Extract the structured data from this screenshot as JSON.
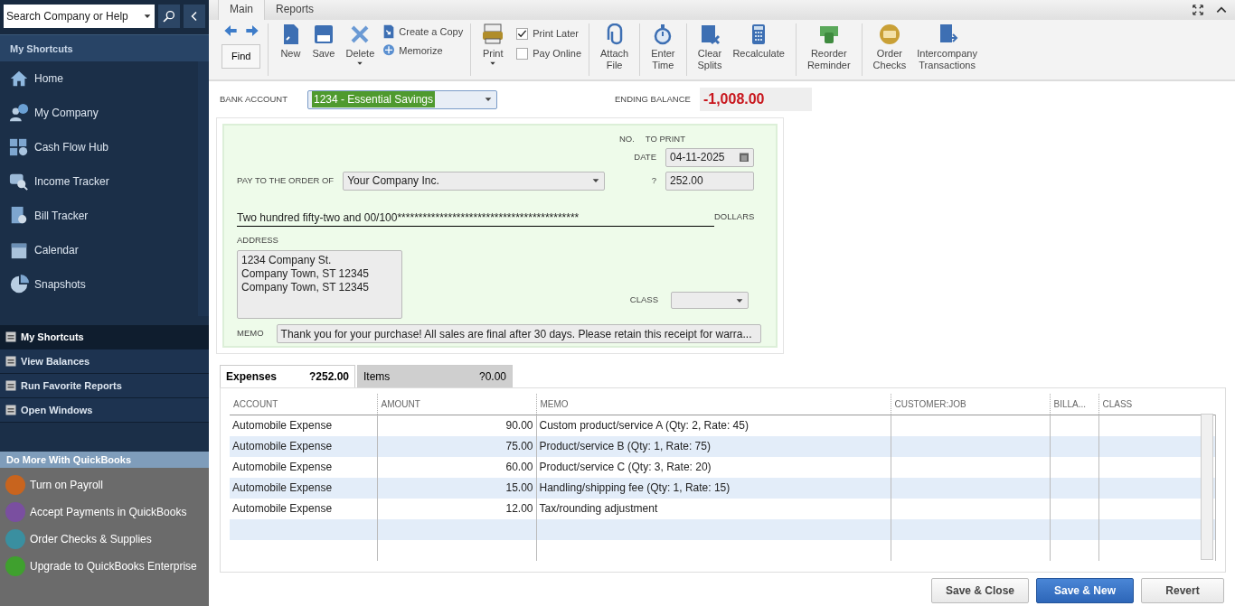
{
  "search": {
    "value": "Search Company or Help"
  },
  "sidebar": {
    "header": "My Shortcuts",
    "shortcuts": [
      {
        "label": "Home"
      },
      {
        "label": "My Company"
      },
      {
        "label": "Cash Flow Hub"
      },
      {
        "label": "Income Tracker"
      },
      {
        "label": "Bill Tracker"
      },
      {
        "label": "Calendar"
      },
      {
        "label": "Snapshots"
      }
    ],
    "sections": [
      {
        "label": "My Shortcuts",
        "selected": true
      },
      {
        "label": "View Balances",
        "selected": false
      },
      {
        "label": "Run Favorite Reports",
        "selected": false
      },
      {
        "label": "Open Windows",
        "selected": false
      }
    ],
    "promo": {
      "title": "Do More With QuickBooks",
      "items": [
        {
          "label": "Turn on Payroll",
          "color": "#c8641e"
        },
        {
          "label": "Accept Payments in QuickBooks",
          "color": "#7a4fa0"
        },
        {
          "label": "Order Checks & Supplies",
          "color": "#3a8fa0"
        },
        {
          "label": "Upgrade to QuickBooks Enterprise",
          "color": "#3fa02e"
        }
      ]
    }
  },
  "tabs": [
    {
      "label": "Main",
      "selected": true
    },
    {
      "label": "Reports",
      "selected": false
    }
  ],
  "toolbar": [
    [
      {
        "kind": "find",
        "label": "Find"
      }
    ],
    [
      {
        "kind": "button",
        "label": "New"
      },
      {
        "kind": "button",
        "label": "Save"
      },
      {
        "kind": "button",
        "label": "Delete",
        "dropdown": true
      },
      {
        "kind": "stack",
        "items": [
          {
            "label": "Create a Copy"
          },
          {
            "label": "Memorize"
          }
        ]
      }
    ],
    [
      {
        "kind": "button",
        "label": "Print",
        "dropdown": true
      },
      {
        "kind": "checks",
        "items": [
          {
            "label": "Print Later",
            "checked": true
          },
          {
            "label": "Pay Online",
            "checked": false
          }
        ]
      }
    ],
    [
      {
        "kind": "button",
        "label": "Attach File"
      }
    ],
    [
      {
        "kind": "button",
        "label": "Enter Time"
      }
    ],
    [
      {
        "kind": "button",
        "label": "Clear Splits"
      },
      {
        "kind": "button",
        "label": "Recalculate"
      }
    ],
    [
      {
        "kind": "button",
        "label": "Reorder Reminder"
      }
    ],
    [
      {
        "kind": "button",
        "label": "Order Checks"
      },
      {
        "kind": "button",
        "label": "Intercompany Transactions"
      }
    ]
  ],
  "bank_account": {
    "label": "BANK ACCOUNT",
    "value": "1234 - Essential Savings"
  },
  "ending_balance": {
    "label": "ENDING BALANCE",
    "value": "-1,008.00"
  },
  "check": {
    "no_label": "NO.",
    "no_value": "TO PRINT",
    "date_label": "DATE",
    "date": "04-11-2025",
    "payee_label": "PAY TO THE ORDER OF",
    "payee": "Your Company Inc.",
    "amount_label": "?",
    "amount": "252.00",
    "amount_words": "Two hundred fifty-two and 00/100*******************************************",
    "dollars_label": "DOLLARS",
    "address_label": "ADDRESS",
    "address": [
      "1234 Company St.",
      "Company Town, ST 12345",
      "Company Town, ST 12345"
    ],
    "class_label": "CLASS",
    "memo_label": "MEMO",
    "memo": "Thank you for your purchase! All sales are final after 30 days. Please retain this receipt for warra..."
  },
  "detail_tabs": [
    {
      "label": "Expenses",
      "total": "?252.00",
      "selected": true
    },
    {
      "label": "Items",
      "total": "?0.00",
      "selected": false
    }
  ],
  "table": {
    "columns": [
      "ACCOUNT",
      "AMOUNT",
      "MEMO",
      "CUSTOMER:JOB",
      "BILLA...",
      "CLASS"
    ],
    "rows": [
      [
        "Automobile Expense",
        "90.00",
        "Custom product/service A (Qty: 2, Rate: 45)"
      ],
      [
        "Automobile Expense",
        "75.00",
        "Product/service B (Qty: 1, Rate: 75)"
      ],
      [
        "Automobile Expense",
        "60.00",
        "Product/service C (Qty: 3, Rate: 20)"
      ],
      [
        "Automobile Expense",
        "15.00",
        "Handling/shipping fee (Qty: 1, Rate: 15)"
      ],
      [
        "Automobile Expense",
        "12.00",
        "Tax/rounding adjustment"
      ]
    ]
  },
  "buttons": [
    {
      "label": "Save & Close",
      "primary": false
    },
    {
      "label": "Save & New",
      "primary": true
    },
    {
      "label": "Revert",
      "primary": false
    }
  ]
}
